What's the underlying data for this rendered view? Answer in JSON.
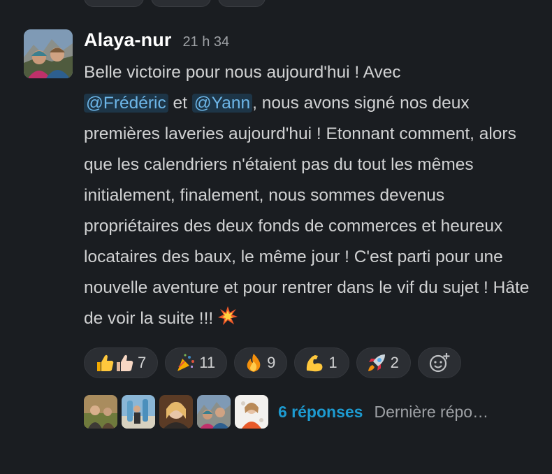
{
  "message": {
    "author": "Alaya-nur",
    "time": "21 h 34",
    "text_1": "Belle victoire pour nous aujourd'hui ! Avec",
    "mention_1": "@Frédéric",
    "text_2": "et",
    "mention_2": "@Yann",
    "text_3": ", nous avons signé nos deux premières laveries aujourd'hui ! Etonnant comment, alors que les calendriers n'étaient pas du tout les mêmes initialement, finalement, nous sommes devenus propriétaires des deux fonds de commerces et heureux locataires des baux, le même jour ! C'est parti pour une nouvelle aventure et pour rentrer dans le vif du sujet ! Hâte de voir la suite !!!",
    "end_emoji": "collision-icon"
  },
  "reactions": [
    {
      "emoji": "thumbs-up-icon",
      "count": "7"
    },
    {
      "emoji": "party-popper-icon",
      "count": "11"
    },
    {
      "emoji": "fire-icon",
      "count": "9"
    },
    {
      "emoji": "flexed-biceps-icon",
      "count": "1"
    },
    {
      "emoji": "rocket-icon",
      "count": "2"
    }
  ],
  "add_reaction_icon": "add-emoji-icon",
  "thread": {
    "replies": "6 réponses",
    "last_reply": "Dernière répo…"
  },
  "colors": {
    "background": "#1a1d21",
    "mention_bg": "#1d3547",
    "mention_text": "#6db6e8",
    "link": "#1d9bd1"
  }
}
